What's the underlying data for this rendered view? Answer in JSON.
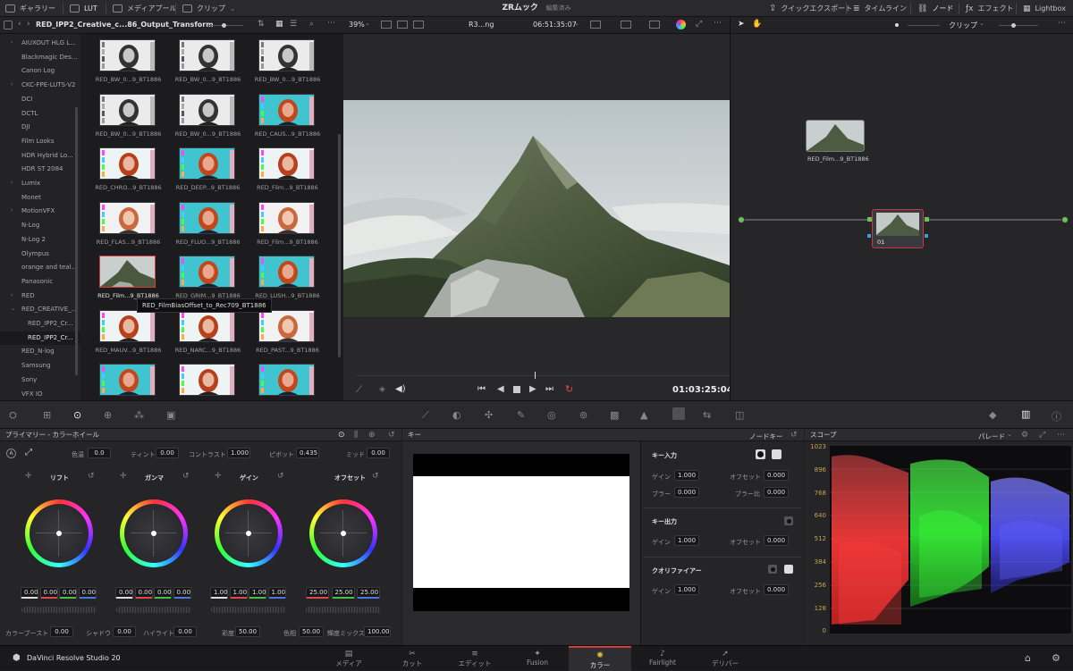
{
  "app": {
    "title": "ZRムック",
    "status": "編集済み",
    "name": "DaVinci Resolve Studio 20"
  },
  "topbar": {
    "gallery": "ギャラリー",
    "lut": "LUT",
    "media_pool": "メディアプール",
    "clips": "クリップ",
    "quick_export": "クイックエクスポート",
    "timeline": "タイムライン",
    "nodes": "ノード",
    "effects": "エフェクト",
    "lightbox": "Lightbox"
  },
  "lut_browser": {
    "path": "RED_IPP2_Creative_c...86_Output_Transform",
    "tree": [
      {
        "label": "AIUXOUT HLG L...",
        "chevron": true
      },
      {
        "label": "Blackmagic Des..."
      },
      {
        "label": "Canon Log"
      },
      {
        "label": "CKC-FPE-LUTS-V2",
        "chevron": true
      },
      {
        "label": "DCI"
      },
      {
        "label": "DCTL"
      },
      {
        "label": "DJI"
      },
      {
        "label": "Film Looks"
      },
      {
        "label": "HDR Hybrid Lo..."
      },
      {
        "label": "HDR ST 2084"
      },
      {
        "label": "Lumix",
        "chevron": true
      },
      {
        "label": "Monet"
      },
      {
        "label": "MotionVFX",
        "chevron": true
      },
      {
        "label": "N-Log"
      },
      {
        "label": "N-Log 2"
      },
      {
        "label": "Olympus"
      },
      {
        "label": "orange and teal..."
      },
      {
        "label": "Panasonic"
      },
      {
        "label": "RED",
        "chevron": true
      },
      {
        "label": "RED_CREATIVE_...",
        "chevron": true,
        "open": true
      },
      {
        "label": "RED_IPP2_Cr...",
        "child": true
      },
      {
        "label": "RED_IPP2_Cr...",
        "child": true,
        "selected": true
      },
      {
        "label": "RED_N-log"
      },
      {
        "label": "Samsung"
      },
      {
        "label": "Sony"
      },
      {
        "label": "VFX IO"
      }
    ],
    "tiles": [
      {
        "name": "RED_BW_0...9_BT1886",
        "style": "bw"
      },
      {
        "name": "RED_BW_0...9_BT1886",
        "style": "bw"
      },
      {
        "name": "RED_BW_0...9_BT1886",
        "style": "bw"
      },
      {
        "name": "RED_BW_0...9_BT1886",
        "style": "bw"
      },
      {
        "name": "RED_BW_0...9_BT1886",
        "style": "bw"
      },
      {
        "name": "RED_CAUS...9_BT1886",
        "style": "teal"
      },
      {
        "name": "RED_CHRO...9_BT1886",
        "style": "color"
      },
      {
        "name": "RED_DEEP...9_BT1886",
        "style": "teal"
      },
      {
        "name": "RED_Film...9_BT1886",
        "style": "color"
      },
      {
        "name": "RED_FLAS...9_BT1886",
        "style": "pale"
      },
      {
        "name": "RED_FLUO...9_BT1886",
        "style": "teal"
      },
      {
        "name": "RED_Film...9_BT1886",
        "style": "pale"
      },
      {
        "name": "RED_Film...9_BT1886",
        "style": "mountain",
        "selected": true
      },
      {
        "name": "RED_GRIM...9_BT1886",
        "style": "teal"
      },
      {
        "name": "RED_LUSH...9_BT1886",
        "style": "teal"
      },
      {
        "name": "RED_MAUV...9_BT1886",
        "style": "color"
      },
      {
        "name": "RED_NARC...9_BT1886",
        "style": "color"
      },
      {
        "name": "RED_PAST...9_BT1886",
        "style": "pale"
      },
      {
        "name": "",
        "style": "teal"
      },
      {
        "name": "",
        "style": "color"
      },
      {
        "name": "",
        "style": "teal"
      }
    ],
    "tooltip": "RED_FilmBiasOffset_to_Rec709_BT1886"
  },
  "viewer": {
    "zoom": "39%",
    "clip_name": "R3...ng",
    "source_tc": "06:51:35:07",
    "timecode": "01:03:25:04"
  },
  "node_editor": {
    "mode": "クリップ",
    "lut_node_label": "RED_Film...9_BT1886",
    "node_label": "01"
  },
  "primaries": {
    "title": "プライマリー - カラーホイール",
    "temp_label": "色温",
    "temp": "0.0",
    "tint_label": "ティント",
    "tint": "0.00",
    "contrast_label": "コントラスト",
    "contrast": "1.000",
    "pivot_label": "ピボット",
    "pivot": "0.435",
    "mid_label": "ミッド",
    "mid": "0.00",
    "wheels": [
      {
        "name": "リフト",
        "values": [
          "0.00",
          "0.00",
          "0.00",
          "0.00"
        ]
      },
      {
        "name": "ガンマ",
        "values": [
          "0.00",
          "0.00",
          "0.00",
          "0.00"
        ]
      },
      {
        "name": "ゲイン",
        "values": [
          "1.00",
          "1.00",
          "1.00",
          "1.00"
        ]
      },
      {
        "name": "オフセット",
        "values": [
          "25.00",
          "25.00",
          "25.00"
        ]
      }
    ],
    "color_boost_label": "カラーブースト",
    "color_boost": "0.00",
    "shadow_label": "シャドウ",
    "shadow": "0.00",
    "highlight_label": "ハイライト",
    "highlight": "0.00",
    "saturation_label": "彩度",
    "saturation": "50.00",
    "hue_label": "色相",
    "hue": "50.00",
    "lum_mix_label": "輝度ミックス",
    "lum_mix": "100.00"
  },
  "key": {
    "title": "キー",
    "node_key": "ノードキー",
    "input_title": "キー入力",
    "gain_label": "ゲイン",
    "gain": "1.000",
    "offset_label": "オフセット",
    "offset": "0.000",
    "blur_label": "ブラー",
    "blur": "0.000",
    "blur_ratio_label": "ブラー比",
    "blur_ratio": "0.000",
    "output_title": "キー出力",
    "out_gain": "1.000",
    "out_offset": "0.000",
    "qualifier_title": "クオリファイアー",
    "q_gain": "1.000",
    "q_offset": "0.000"
  },
  "scope": {
    "title": "スコープ",
    "mode": "パレード",
    "ticks": [
      "1023",
      "896",
      "768",
      "640",
      "512",
      "384",
      "256",
      "128",
      "0"
    ]
  },
  "pages": [
    {
      "label": "メディア",
      "icon": "▤"
    },
    {
      "label": "カット",
      "icon": "✂"
    },
    {
      "label": "エディット",
      "icon": "≡"
    },
    {
      "label": "Fusion",
      "icon": "✦"
    },
    {
      "label": "カラー",
      "icon": "✺",
      "active": true
    },
    {
      "label": "Fairlight",
      "icon": "♪"
    },
    {
      "label": "デリバー",
      "icon": "➚"
    }
  ],
  "colors": {
    "accent": "#d43a3a",
    "scope_label": "#c8a24a",
    "node_green": "#6ac05a"
  }
}
